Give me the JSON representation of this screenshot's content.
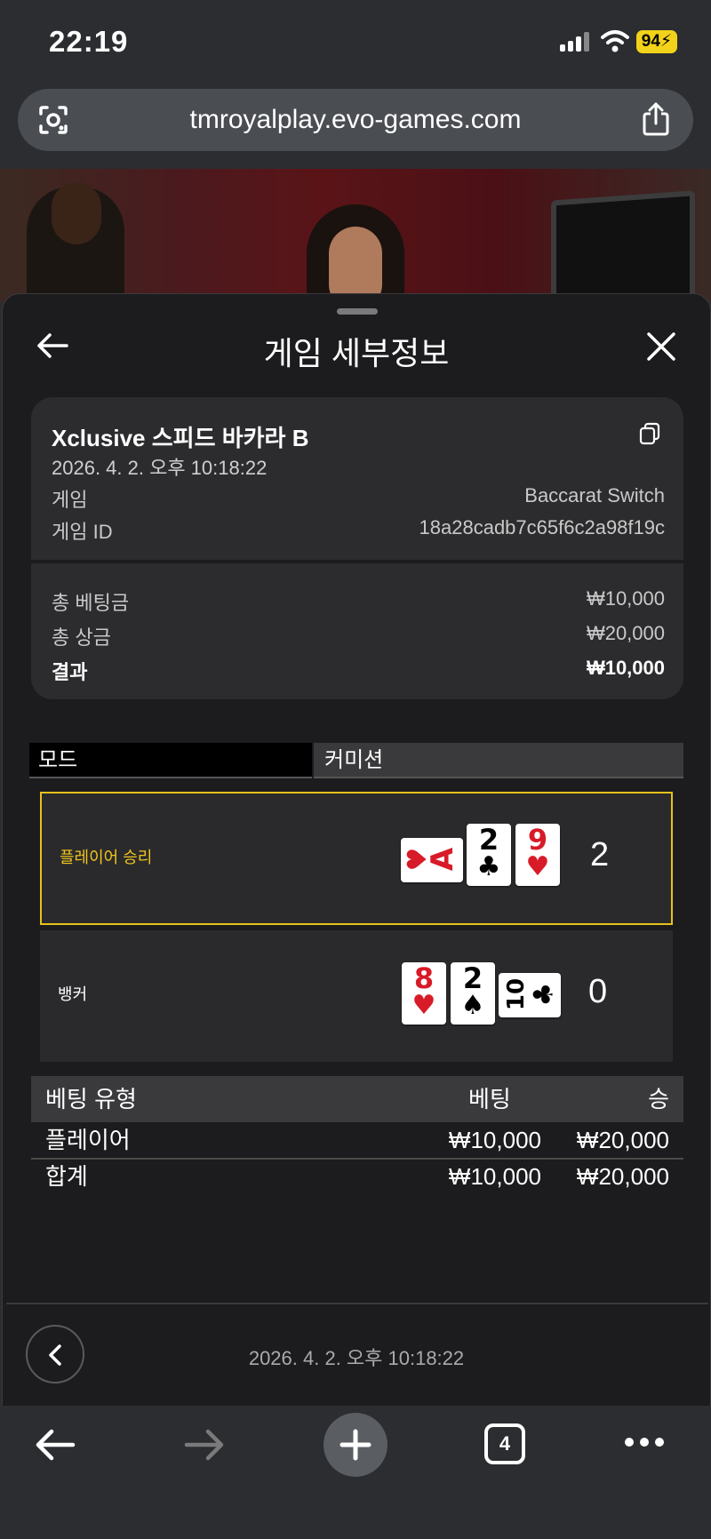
{
  "status_bar": {
    "time": "22:19",
    "battery": "94"
  },
  "browser": {
    "url": "tmroyalplay.evo-games.com",
    "tab_count": "4"
  },
  "sheet": {
    "title": "게임 세부정보",
    "game_title": "Xclusive 스피드 바카라 B",
    "game_datetime": "2026. 4. 2. 오후 10:18:22",
    "info_rows": [
      {
        "label": "게임",
        "value": "Baccarat Switch"
      },
      {
        "label": "게임 ID",
        "value": "18a28cadb7c65f6c2a98f19c"
      }
    ],
    "summary_rows": [
      {
        "label": "총 베팅금",
        "value": "₩10,000"
      },
      {
        "label": "총 상금",
        "value": "₩20,000"
      },
      {
        "label": "결과",
        "value": "₩10,000"
      }
    ],
    "mode": {
      "label": "모드",
      "value": "커미션"
    },
    "hands": [
      {
        "label": "플레이어 승리",
        "score": "2",
        "winner": true,
        "cards": [
          {
            "rank": "A",
            "suit": "♥",
            "color": "#d81b28",
            "orientation": "sideways"
          },
          {
            "rank": "2",
            "suit": "♣",
            "color": "#000000",
            "orientation": "upright"
          },
          {
            "rank": "9",
            "suit": "♥",
            "color": "#d81b28",
            "orientation": "upright"
          }
        ]
      },
      {
        "label": "뱅커",
        "score": "0",
        "winner": false,
        "cards": [
          {
            "rank": "8",
            "suit": "♥",
            "color": "#d81b28",
            "orientation": "upright"
          },
          {
            "rank": "2",
            "suit": "♠",
            "color": "#000000",
            "orientation": "upright"
          },
          {
            "rank": "10",
            "suit": "♣",
            "color": "#000000",
            "orientation": "sideways"
          }
        ]
      }
    ],
    "bet_table": {
      "headers": [
        "베팅 유형",
        "베팅",
        "승"
      ],
      "rows": [
        {
          "type": "플레이어",
          "bet": "₩10,000",
          "win": "₩20,000"
        }
      ],
      "total": {
        "type": "합계",
        "bet": "₩10,000",
        "win": "₩20,000"
      }
    },
    "footer_datetime": "2026. 4. 2. 오후 10:18:22"
  },
  "colors": {
    "win_highlight": "#e6c21a",
    "card_red": "#d81b28",
    "battery": "#f2d21a"
  }
}
